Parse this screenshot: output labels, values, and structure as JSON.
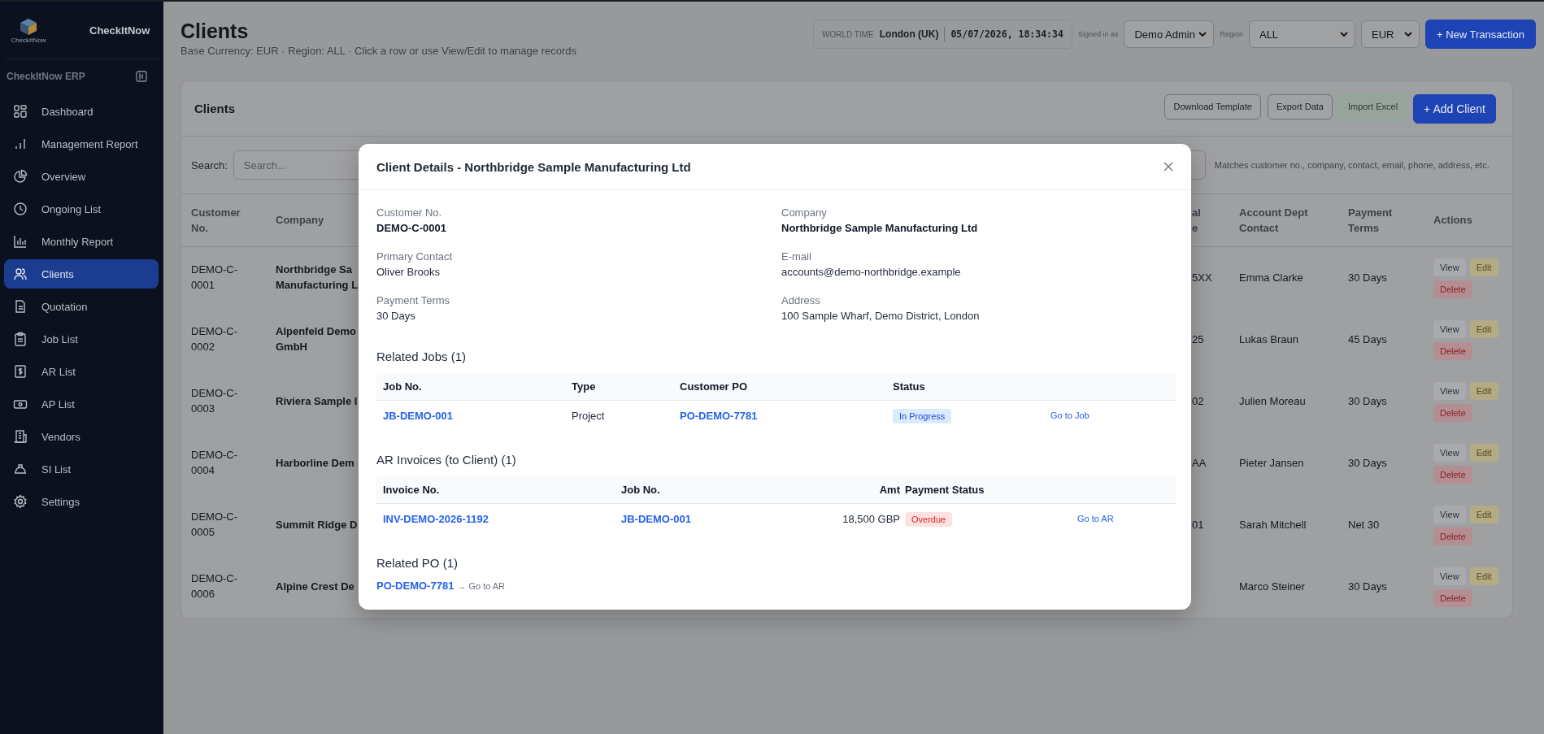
{
  "sidebar": {
    "logo_caption": "CheckItNow",
    "brand": "CheckItNow",
    "section": "CheckItNow ERP",
    "items": [
      {
        "label": "Dashboard",
        "selected": false
      },
      {
        "label": "Management Report",
        "selected": false
      },
      {
        "label": "Overview",
        "selected": false
      },
      {
        "label": "Ongoing List",
        "selected": false
      },
      {
        "label": "Monthly Report",
        "selected": false
      },
      {
        "label": "Clients",
        "selected": true
      },
      {
        "label": "Quotation",
        "selected": false
      },
      {
        "label": "Job List",
        "selected": false
      },
      {
        "label": "AR List",
        "selected": false
      },
      {
        "label": "AP List",
        "selected": false
      },
      {
        "label": "Vendors",
        "selected": false
      },
      {
        "label": "SI List",
        "selected": false
      },
      {
        "label": "Settings",
        "selected": false
      }
    ]
  },
  "header": {
    "title": "Clients",
    "subtitle": "Base Currency: EUR · Region: ALL · Click a row or use View/Edit to manage records",
    "world_time": {
      "label": "WORLD TIME",
      "city": "London (UK)",
      "time": "05/07/2026, 18:34:34"
    },
    "signed_in": {
      "label": "Signed in as",
      "value": "Demo Admin"
    },
    "region": {
      "label": "Region",
      "value": "ALL"
    },
    "currency": {
      "value": "EUR"
    },
    "new_button": "+ New Transaction"
  },
  "card": {
    "title": "Clients",
    "buttons": [
      {
        "label": "Download Template",
        "kind": "plain"
      },
      {
        "label": "Export Data",
        "kind": "plain"
      },
      {
        "label": "Import Excel",
        "kind": "green"
      },
      {
        "label": "+ Add Client",
        "kind": "primary"
      }
    ],
    "search": {
      "label": "Search:",
      "placeholder": "Search...",
      "hint": "Matches customer no., company, contact, email, phone, address, etc."
    },
    "columns": [
      "Customer No.",
      "Company",
      "al\ne",
      "Account Dept Contact",
      "Payment Terms",
      "Actions"
    ],
    "rows": [
      {
        "customer_no": "DEMO-C-0001",
        "company": "Northbridge Sa\nManufacturing L",
        "column_3": "5XX",
        "contact": "Emma Clarke",
        "terms": "30 Days",
        "actions": [
          {
            "label": "View",
            "kind": "view"
          },
          {
            "label": "Edit",
            "kind": "edit"
          },
          {
            "label": "Delete",
            "kind": "delete"
          }
        ]
      },
      {
        "customer_no": "DEMO-C-0002",
        "company": "Alpenfeld Demo\nGmbH",
        "column_3": "25",
        "contact": "Lukas Braun",
        "terms": "45 Days",
        "actions": [
          {
            "label": "View",
            "kind": "view"
          },
          {
            "label": "Edit",
            "kind": "edit"
          },
          {
            "label": "Delete",
            "kind": "delete"
          }
        ]
      },
      {
        "customer_no": "DEMO-C-0003",
        "company": "Riviera Sample I",
        "column_3": "02",
        "contact": "Julien Moreau",
        "terms": "30 Days",
        "actions": [
          {
            "label": "View",
            "kind": "view"
          },
          {
            "label": "Edit",
            "kind": "edit"
          },
          {
            "label": "Delete",
            "kind": "delete"
          }
        ]
      },
      {
        "customer_no": "DEMO-C-0004",
        "company": "Harborline Dem",
        "column_3": "AA",
        "contact": "Pieter Jansen",
        "terms": "30 Days",
        "actions": [
          {
            "label": "View",
            "kind": "view"
          },
          {
            "label": "Edit",
            "kind": "edit"
          },
          {
            "label": "Delete",
            "kind": "delete"
          }
        ]
      },
      {
        "customer_no": "DEMO-C-0005",
        "company": "Summit Ridge D",
        "column_3": "01",
        "contact": "Sarah Mitchell",
        "terms": "Net 30",
        "actions": [
          {
            "label": "View",
            "kind": "view"
          },
          {
            "label": "Edit",
            "kind": "edit"
          },
          {
            "label": "Delete",
            "kind": "delete"
          }
        ]
      },
      {
        "customer_no": "DEMO-C-0006",
        "company": "Alpine Crest De",
        "contact": "Marco Steiner",
        "terms": "30 Days",
        "actions": [
          {
            "label": "View",
            "kind": "view"
          },
          {
            "label": "Edit",
            "kind": "edit"
          },
          {
            "label": "Delete",
            "kind": "delete"
          }
        ]
      }
    ]
  },
  "modal": {
    "title": "Client Details - Northbridge Sample Manufacturing Ltd",
    "fields": [
      {
        "label": "Customer No.",
        "value": "DEMO-C-0001",
        "emphasis": true
      },
      {
        "label": "Company",
        "value": "Northbridge Sample Manufacturing Ltd",
        "emphasis": true
      },
      {
        "label": "Primary Contact",
        "value": "Oliver Brooks",
        "emphasis": false
      },
      {
        "label": "E-mail",
        "value": "accounts@demo-northbridge.example",
        "emphasis": false
      },
      {
        "label": "Payment Terms",
        "value": "30 Days",
        "emphasis": false
      },
      {
        "label": "Address",
        "value": "100 Sample Wharf, Demo District, London",
        "emphasis": false
      }
    ],
    "related_jobs": {
      "title": "Related Jobs (1)",
      "columns": [
        "Job No.",
        "Type",
        "Customer PO",
        "Status"
      ],
      "rows": [
        {
          "job_no": "JB-DEMO-001",
          "type": "Project",
          "customer_po": "PO-DEMO-7781",
          "status": {
            "label": "In Progress",
            "kind": "progress"
          },
          "link": "Go to Job"
        }
      ]
    },
    "ar_invoices": {
      "title": "AR Invoices (to Client) (1)",
      "columns": [
        "Invoice No.",
        "Job No.",
        "Amt",
        "Payment Status"
      ],
      "rows": [
        {
          "invoice_no": "INV-DEMO-2026-1192",
          "job_no": "JB-DEMO-001",
          "amt": "18,500 GBP",
          "status": {
            "label": "Overdue",
            "kind": "overdue"
          },
          "link": "Go to AR"
        }
      ]
    },
    "related_po": {
      "title": "Related PO (1)",
      "items": [
        {
          "po": "PO-DEMO-7781",
          "link": "→ Go to AR"
        }
      ]
    }
  }
}
